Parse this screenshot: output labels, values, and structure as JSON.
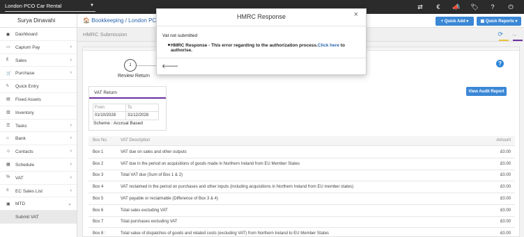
{
  "topbar": {
    "company": "London PCO Car Rental",
    "icons": [
      "transfer-icon",
      "euro-icon",
      "megaphone-icon",
      "tag-icon",
      "help-icon",
      "power-icon"
    ]
  },
  "sidebar": {
    "user": "Surya Dinavahi",
    "items": [
      {
        "label": "Dashboard",
        "icon": "dashboard-icon",
        "chevron": false
      },
      {
        "label": "Capium Pay",
        "icon": "card-icon",
        "chevron": true
      },
      {
        "label": "Sales",
        "icon": "pound-icon",
        "chevron": true
      },
      {
        "label": "Purchase",
        "icon": "cart-icon",
        "chevron": true
      },
      {
        "label": "Quick Entry",
        "icon": "bolt-icon",
        "chevron": false
      },
      {
        "label": "Fixed Assets",
        "icon": "assets-icon",
        "chevron": false
      },
      {
        "label": "Inventory",
        "icon": "inventory-icon",
        "chevron": false
      },
      {
        "label": "Tasks",
        "icon": "tasks-icon",
        "chevron": true
      },
      {
        "label": "Bank",
        "icon": "bank-icon",
        "chevron": true
      },
      {
        "label": "Contacts",
        "icon": "contacts-icon",
        "chevron": true
      },
      {
        "label": "Schedule",
        "icon": "calendar-icon",
        "chevron": true
      },
      {
        "label": "VAT",
        "icon": "vat-icon",
        "chevron": true
      },
      {
        "label": "EC Sales List",
        "icon": "list-icon",
        "chevron": true
      },
      {
        "label": "MTD",
        "icon": "mtd-icon",
        "chevron": true
      }
    ],
    "sub_item": "Submit VAT"
  },
  "header": {
    "breadcrumb_1": "Bookkeeping",
    "breadcrumb_sep": "/",
    "breadcrumb_2": "London PCO",
    "quick_add": "Quick Add",
    "quick_reports": "Quick Reports",
    "subtitle": "HMRC Submission"
  },
  "main": {
    "step_number": "1",
    "step_label": "Review Return",
    "audit_button": "View Audit Report",
    "vat_return": {
      "title": "VAT Return",
      "from_label": "From",
      "to_label": "To",
      "from": "01/10/2028",
      "to": "31/12/2028",
      "scheme": "Scheme : Accrual Based"
    },
    "table": {
      "headers": {
        "box": "Box No.",
        "desc": "VAT Description",
        "amount": "Amount"
      },
      "rows": [
        {
          "box": "Box 1",
          "desc": "VAT due on sales and other outputs",
          "amount": "£0.00"
        },
        {
          "box": "Box 2",
          "desc": "VAT due in the period on acquisitions of goods made in Northern Ireland from EU Member States",
          "amount": "£0.00"
        },
        {
          "box": "Box 3",
          "desc": "Total VAT due (Sum of Box 1 & 2)",
          "amount": "£0.00"
        },
        {
          "box": "Box 4",
          "desc": "VAT reclaimed in the period on purchases and other inputs (including acquisitions in Northern Ireland from EU member states)",
          "amount": "£0.00"
        },
        {
          "box": "Box 5",
          "desc": "VAT payable or reclaimable (Difference of Box 3 & 4)",
          "amount": "£0.00"
        },
        {
          "box": "Box 6",
          "desc": "Total sales excluding VAT",
          "amount": "£0.00"
        },
        {
          "box": "Box 7",
          "desc": "Total purchases excluding VAT",
          "amount": "£0.00"
        },
        {
          "box": "Box 8 :",
          "desc": "Total value of dispatches of goods and related costs (excluding VAT) from Northern Ireland to EU Member States",
          "amount": "£0.00"
        }
      ]
    }
  },
  "modal": {
    "title": "HMRC Response",
    "close": "×",
    "message": "Vat not submitted",
    "bullet_prefix": "HMRC Response - This error regarding to the authorization process.",
    "link": "Click here",
    "bullet_suffix": " to authorise.",
    "back": "🡐"
  },
  "colors": {
    "accent": "#3a87d6",
    "sidebar_active": "#6a2fa0",
    "topbar": "#2b2b2b"
  }
}
